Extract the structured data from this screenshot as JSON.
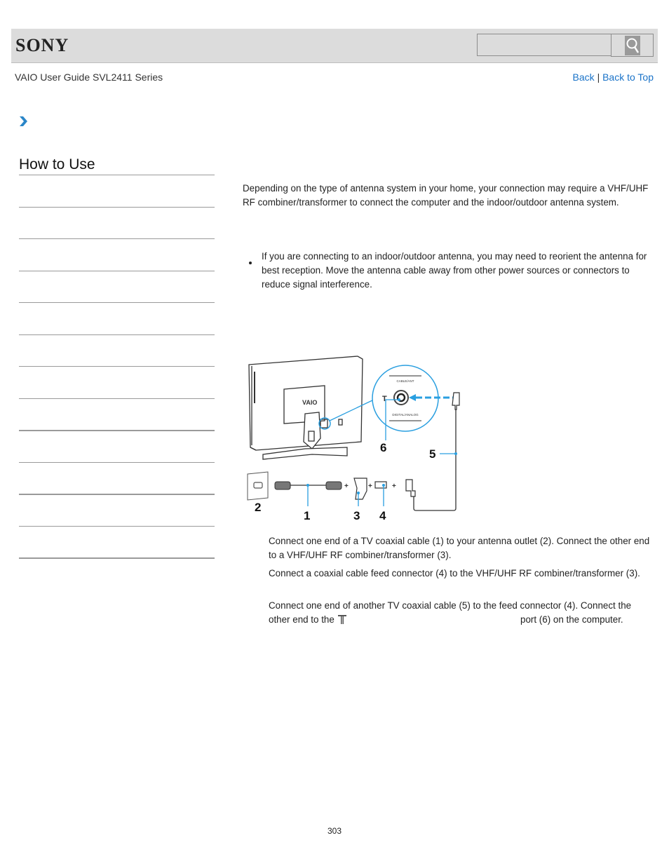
{
  "header": {
    "logo": "SONY",
    "search": {
      "placeholder": "",
      "value": "",
      "button_icon": "search-icon"
    }
  },
  "subheader": {
    "guide_title": "VAIO User Guide SVL2411 Series",
    "links": {
      "back": "Back",
      "separator": "|",
      "back_to_top": "Back to Top"
    }
  },
  "breadcrumb": {
    "icon": "chevron-right-icon"
  },
  "sidebar": {
    "title": "How to Use",
    "items": [
      "",
      "",
      "",
      "",
      "",
      "",
      "",
      "",
      "",
      "",
      "",
      ""
    ]
  },
  "content": {
    "intro": "Depending on the type of antenna system in your home, your connection may require a VHF/UHF RF combiner/transformer to connect the computer and the indoor/outdoor antenna system.",
    "note": "If you are connecting to an indoor/outdoor antenna, you may need to reorient the antenna for best reception. Move the antenna cable away from other power sources or connectors to reduce signal interference.",
    "figure": {
      "labels": [
        "1",
        "2",
        "3",
        "4",
        "5",
        "6"
      ],
      "port_top_label": "CABLE/ANT",
      "port_bottom_label": "DIGITAL/ANALOG",
      "brand_mark": "VAIO",
      "accent_color": "#2a9fe0"
    },
    "steps": [
      "Connect one end of a TV coaxial cable (1) to your antenna outlet (2). Connect the other end to a VHF/UHF RF combiner/transformer (3).",
      "Connect a coaxial cable feed connector (4) to the VHF/UHF RF combiner/transformer (3).",
      {
        "before": "Connect one end of another TV coaxial cable (5) to the feed connector (4). Connect the other end to the",
        "after": "port (6) on the computer."
      }
    ]
  },
  "footer": {
    "page_number": "303"
  }
}
